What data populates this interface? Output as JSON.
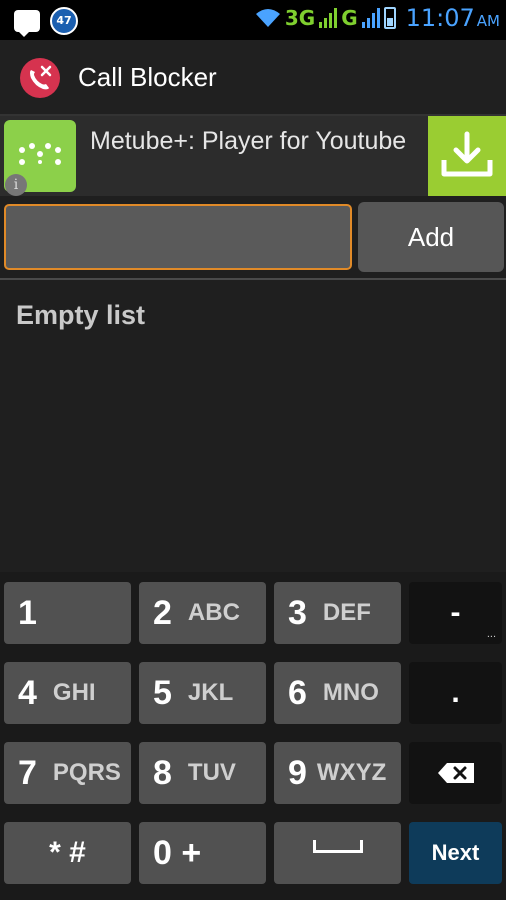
{
  "status_bar": {
    "notification_count": "47",
    "network_1": "3G",
    "network_2": "G",
    "time": "11:07",
    "ampm": "AM",
    "colors": {
      "green": "#7fcf2f",
      "blue": "#4aa3ff"
    }
  },
  "action_bar": {
    "title": "Call Blocker",
    "icon": "phone-blocked-icon"
  },
  "ad": {
    "title": "Metube+: Player for Youtube",
    "info_glyph": "i",
    "icon": "metube-app-icon",
    "download_icon": "download-icon",
    "accent": "#9acd32"
  },
  "input": {
    "value": "",
    "placeholder": "",
    "add_label": "Add"
  },
  "list": {
    "empty_text": "Empty list"
  },
  "keyboard": {
    "row1": [
      {
        "num": "1",
        "sub": ""
      },
      {
        "num": "2",
        "sub": "ABC"
      },
      {
        "num": "3",
        "sub": "DEF"
      },
      {
        "label": "-"
      }
    ],
    "row2": [
      {
        "num": "4",
        "sub": "GHI"
      },
      {
        "num": "5",
        "sub": "JKL"
      },
      {
        "num": "6",
        "sub": "MNO"
      },
      {
        "label": "."
      }
    ],
    "row3": [
      {
        "num": "7",
        "sub": "PQRS"
      },
      {
        "num": "8",
        "sub": "TUV"
      },
      {
        "num": "9",
        "sub": "WXYZ"
      },
      {
        "label": "backspace"
      }
    ],
    "row4": [
      {
        "label": "* #"
      },
      {
        "label": "0 +"
      },
      {
        "label": "space"
      },
      {
        "label": "Next"
      }
    ]
  }
}
